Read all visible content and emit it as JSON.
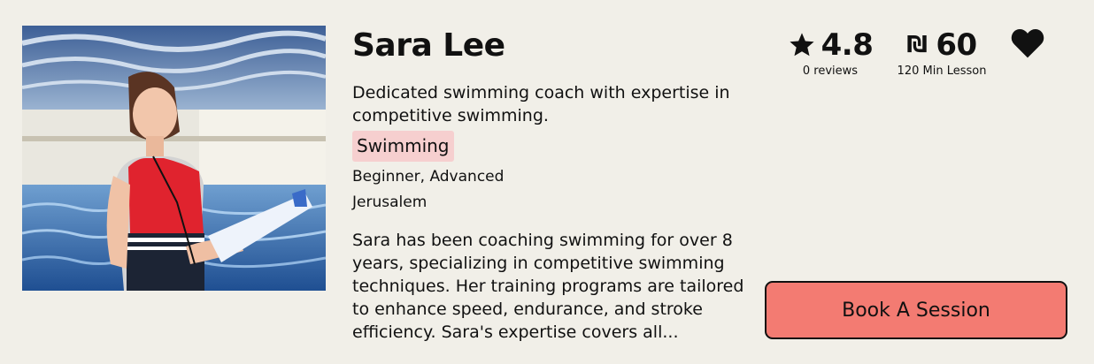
{
  "coach": {
    "name": "Sara Lee",
    "tagline": "Dedicated swimming coach with expertise in competitive swimming.",
    "sport": "Swimming",
    "levels": "Beginner, Advanced",
    "city": "Jerusalem",
    "bio": "Sara has been coaching swimming for over 8 years, specializing in competitive swimming techniques. Her training programs are tailored to enhance speed, endurance, and stroke efficiency. Sara's expertise covers all..."
  },
  "rating": {
    "value": "4.8",
    "reviews": "0 reviews",
    "icon": "star-icon"
  },
  "price": {
    "currency_symbol": "₪",
    "value": "60",
    "unit": "120 Min Lesson",
    "icon": "shekel-icon"
  },
  "favorite": {
    "icon": "heart-icon"
  },
  "book_button": {
    "label": "Book A Session",
    "color": "#f37b72"
  },
  "colors": {
    "background": "#f1efe8",
    "sport_tag": "#f6cfcf"
  }
}
